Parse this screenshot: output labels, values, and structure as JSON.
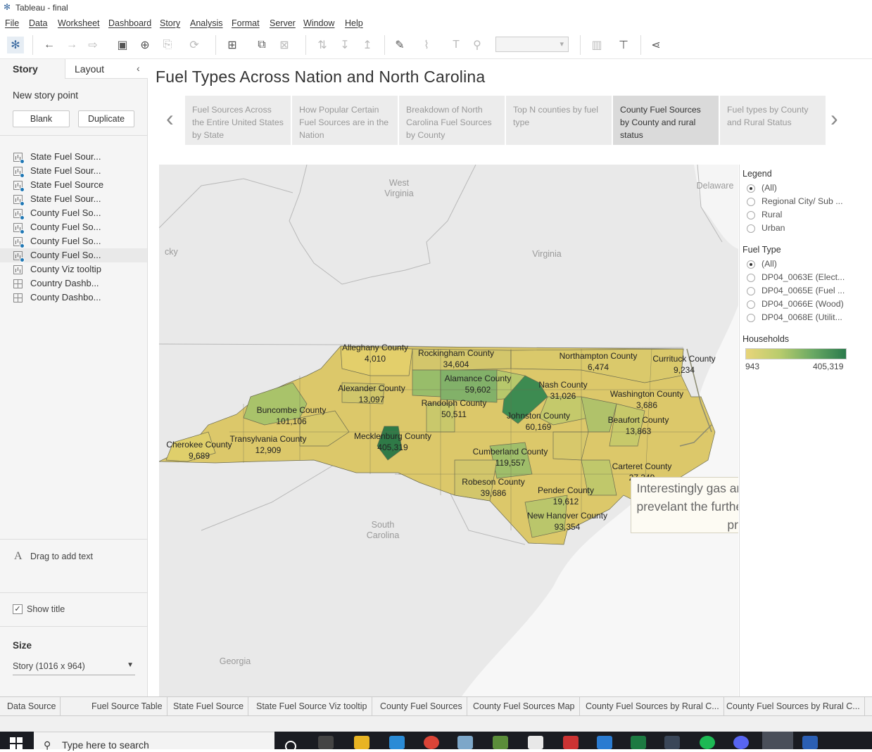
{
  "window": {
    "title": "Tableau - final"
  },
  "menu": [
    "File",
    "Data",
    "Worksheet",
    "Dashboard",
    "Story",
    "Analysis",
    "Format",
    "Server",
    "Window",
    "Help"
  ],
  "sidebar": {
    "tabs": [
      "Story",
      "Layout"
    ],
    "new_story_point": "New story point",
    "blank_button": "Blank",
    "duplicate_button": "Duplicate",
    "sheets": [
      {
        "label": "State Fuel Sour...",
        "type": "sheet",
        "used": true
      },
      {
        "label": "State Fuel Sour...",
        "type": "sheet",
        "used": true
      },
      {
        "label": "State Fuel Source",
        "type": "sheet",
        "used": true
      },
      {
        "label": "State Fuel Sour...",
        "type": "sheet",
        "used": true
      },
      {
        "label": "County Fuel So...",
        "type": "sheet",
        "used": true
      },
      {
        "label": "County Fuel So...",
        "type": "sheet",
        "used": true
      },
      {
        "label": "County Fuel So...",
        "type": "sheet",
        "used": true
      },
      {
        "label": "County Fuel So...",
        "type": "sheet",
        "used": true,
        "selected": true
      },
      {
        "label": "County Viz tooltip",
        "type": "sheet",
        "used": false
      },
      {
        "label": "Country Dashb...",
        "type": "dashboard",
        "used": false
      },
      {
        "label": "County Dashbo...",
        "type": "dashboard",
        "used": false
      }
    ],
    "drag_text": "Drag to add text",
    "show_title_label": "Show title",
    "size_heading": "Size",
    "size_value": "Story (1016 x 964)"
  },
  "story": {
    "title": "Fuel Types Across Nation and North Carolina",
    "points": [
      "Fuel Sources Across the Entire United States by State",
      "How Popular Certain Fuel Sources are in the Nation",
      "Breakdown of North Carolina Fuel Sources by County",
      "Top N counties by fuel type",
      "County Fuel Sources by County and rural status",
      "Fuel types by County and Rural Status"
    ],
    "active_index": 4
  },
  "map": {
    "region_labels": [
      "West Virginia",
      "Virginia",
      "Delaware",
      "South Carolina",
      "Georgia",
      "cky"
    ],
    "counties": [
      {
        "name": "Alleghany County",
        "value": "4,010"
      },
      {
        "name": "Rockingham County",
        "value": "34,604"
      },
      {
        "name": "Northampton County",
        "value": "6,474"
      },
      {
        "name": "Currituck County",
        "value": "9,234"
      },
      {
        "name": "Alamance County",
        "value": "59,602"
      },
      {
        "name": "Alexander County",
        "value": "13,097"
      },
      {
        "name": "Nash County",
        "value": "31,026"
      },
      {
        "name": "Washington County",
        "value": "3,686"
      },
      {
        "name": "Buncombe County",
        "value": "101,106"
      },
      {
        "name": "Randolph County",
        "value": "50,511"
      },
      {
        "name": "Johnston County",
        "value": "60,169"
      },
      {
        "name": "Beaufort County",
        "value": "13,863"
      },
      {
        "name": "Cherokee County",
        "value": "9,689"
      },
      {
        "name": "Transylvania County",
        "value": "12,909"
      },
      {
        "name": "Mecklenburg County",
        "value": "405,319"
      },
      {
        "name": "Cumberland County",
        "value": "119,557"
      },
      {
        "name": "Carteret County",
        "value": "27,349"
      },
      {
        "name": "Robeson County",
        "value": "39,686"
      },
      {
        "name": "Pender County",
        "value": "19,612"
      },
      {
        "name": "New Hanover County",
        "value": "93,354"
      }
    ],
    "annotation": "Interestingly gas and wood both get more prevelant the further west in the state you proceed"
  },
  "legend": {
    "legend_heading": "Legend",
    "legend_options": [
      "(All)",
      "Regional City/ Sub ...",
      "Rural",
      "Urban"
    ],
    "fuel_heading": "Fuel Type",
    "fuel_options": [
      "(All)",
      "DP04_0063E (Elect...",
      "DP04_0065E (Fuel ...",
      "DP04_0066E (Wood)",
      "DP04_0068E (Utilit..."
    ],
    "households_heading": "Households",
    "min": "943",
    "max": "405,319",
    "colors": {
      "low": "#e8d57a",
      "high": "#2a7a4b"
    }
  },
  "sheet_tabs": [
    "Data Source",
    "Fuel Source Table",
    "State Fuel Source",
    "State Fuel Source Viz tooltip",
    "County Fuel Sources",
    "County Fuel Sources Map",
    "County Fuel Sources by Rural C...",
    "County Fuel Sources by Rural C..."
  ],
  "taskbar": {
    "search_placeholder": "Type here to search"
  }
}
